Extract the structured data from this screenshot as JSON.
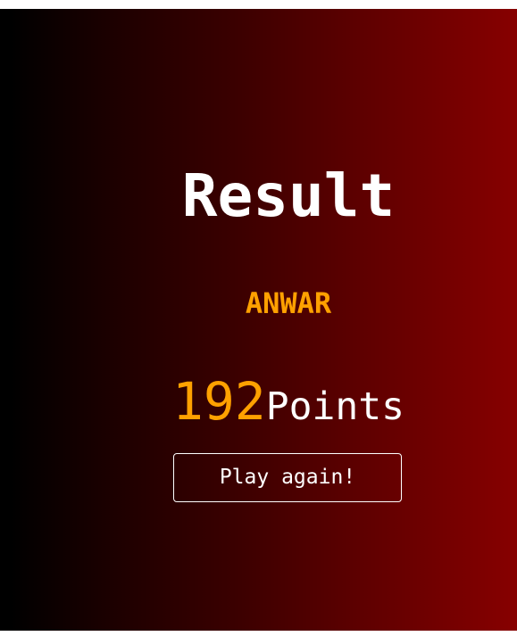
{
  "result": {
    "title": "Result",
    "player_name": "ANWAR",
    "score": "192",
    "score_unit": "Points",
    "play_again_label": "Play again!"
  },
  "colors": {
    "accent": "#ffa100",
    "text": "#ffffff",
    "gradient_start": "#000000",
    "gradient_end": "#870000"
  }
}
